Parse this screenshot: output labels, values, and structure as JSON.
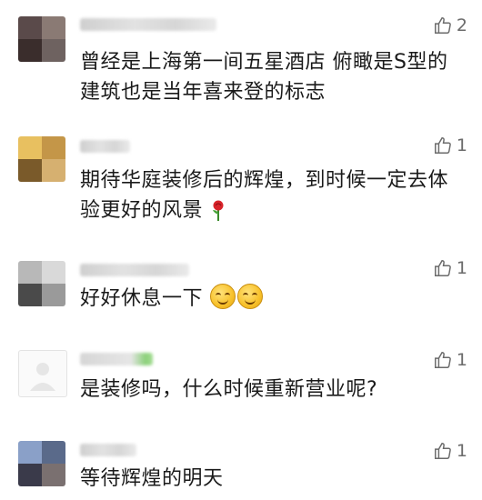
{
  "comments": [
    {
      "text": "曾经是上海第一间五星酒店 俯瞰是S型的建筑也是当年喜来登的标志",
      "likes": "2",
      "emoji": ""
    },
    {
      "text": "期待华庭装修后的辉煌，到时候一定去体验更好的风景",
      "likes": "1",
      "emoji": "rose-icon"
    },
    {
      "text": "好好休息一下",
      "likes": "1",
      "emoji": "smile-icon x2"
    },
    {
      "text": "是装修吗，什么时候重新营业呢?",
      "likes": "1",
      "emoji": ""
    },
    {
      "text": "等待辉煌的明天",
      "likes": "1",
      "emoji": ""
    }
  ],
  "icons": {
    "like": "thumb-up-icon"
  },
  "colors": {
    "text": "#1a1a1a",
    "like": "#6b6b6b",
    "background": "#ffffff"
  }
}
